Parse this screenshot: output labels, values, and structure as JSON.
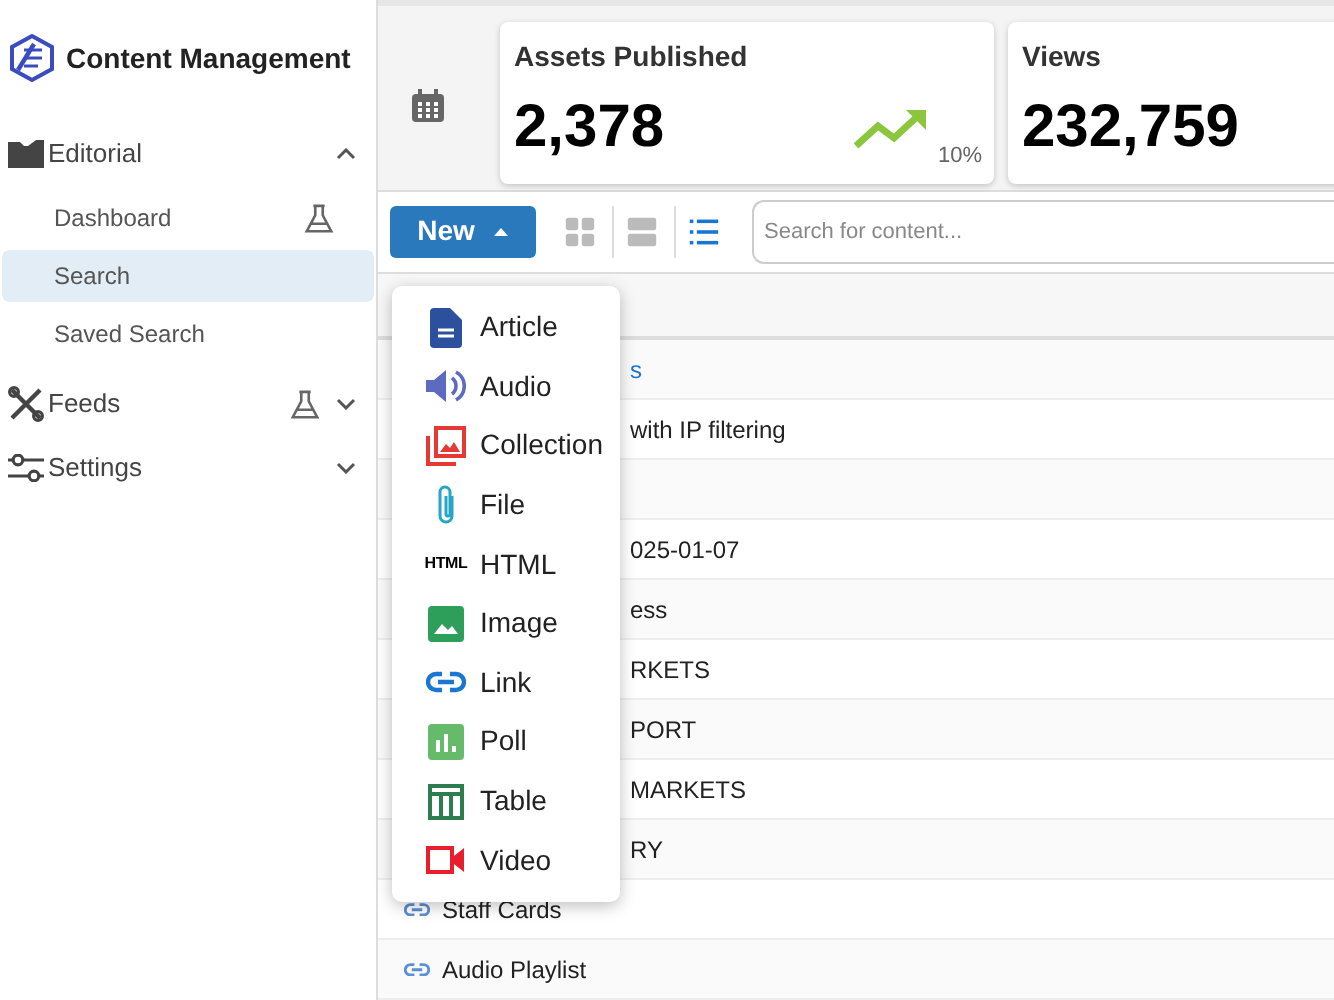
{
  "sidebar": {
    "title": "Content Management",
    "sections": [
      {
        "kind": "folder",
        "label": "Editorial",
        "expanded": true,
        "lab": false,
        "children": [
          {
            "label": "Dashboard",
            "lab": true,
            "selected": false
          },
          {
            "label": "Search",
            "lab": false,
            "selected": true
          },
          {
            "label": "Saved Search",
            "lab": false,
            "selected": false
          }
        ]
      },
      {
        "kind": "feeds",
        "label": "Feeds",
        "expanded": false,
        "lab": true
      },
      {
        "kind": "settings",
        "label": "Settings",
        "expanded": false,
        "lab": false
      }
    ]
  },
  "stats": [
    {
      "title": "Assets Published",
      "value": "2,378",
      "trend": "10%"
    },
    {
      "title": "Views",
      "value": "232,759"
    }
  ],
  "toolbar": {
    "new_button": "New",
    "views": [
      {
        "kind": "grid",
        "selected": false
      },
      {
        "kind": "rows",
        "selected": false
      },
      {
        "kind": "list",
        "selected": true
      }
    ],
    "search": {
      "placeholder": "Search for content..."
    }
  },
  "table": {
    "rows": [
      {
        "kind": "partial",
        "text": "s",
        "link": true
      },
      {
        "kind": "partial",
        "text": "with IP filtering",
        "link": false
      },
      {
        "kind": "empty"
      },
      {
        "kind": "partial",
        "text": "025-01-07",
        "link": false
      },
      {
        "kind": "partial",
        "text": "ess",
        "link": false
      },
      {
        "kind": "partial",
        "text": "RKETS",
        "link": false
      },
      {
        "kind": "partial",
        "text": "PORT",
        "link": false
      },
      {
        "kind": "partial",
        "text": "MARKETS",
        "link": false
      },
      {
        "kind": "partial",
        "text": "RY",
        "link": false
      },
      {
        "kind": "full",
        "text": "Staff Cards"
      },
      {
        "kind": "full",
        "text": "Audio Playlist"
      }
    ]
  },
  "new_menu": {
    "items": [
      {
        "kind": "article",
        "label": "Article"
      },
      {
        "kind": "audio",
        "label": "Audio"
      },
      {
        "kind": "collection",
        "label": "Collection"
      },
      {
        "kind": "file",
        "label": "File"
      },
      {
        "kind": "html",
        "label": "HTML",
        "icon_text": "HTML"
      },
      {
        "kind": "image",
        "label": "Image"
      },
      {
        "kind": "link",
        "label": "Link"
      },
      {
        "kind": "poll",
        "label": "Poll"
      },
      {
        "kind": "table",
        "label": "Table"
      },
      {
        "kind": "video",
        "label": "Video"
      }
    ]
  }
}
